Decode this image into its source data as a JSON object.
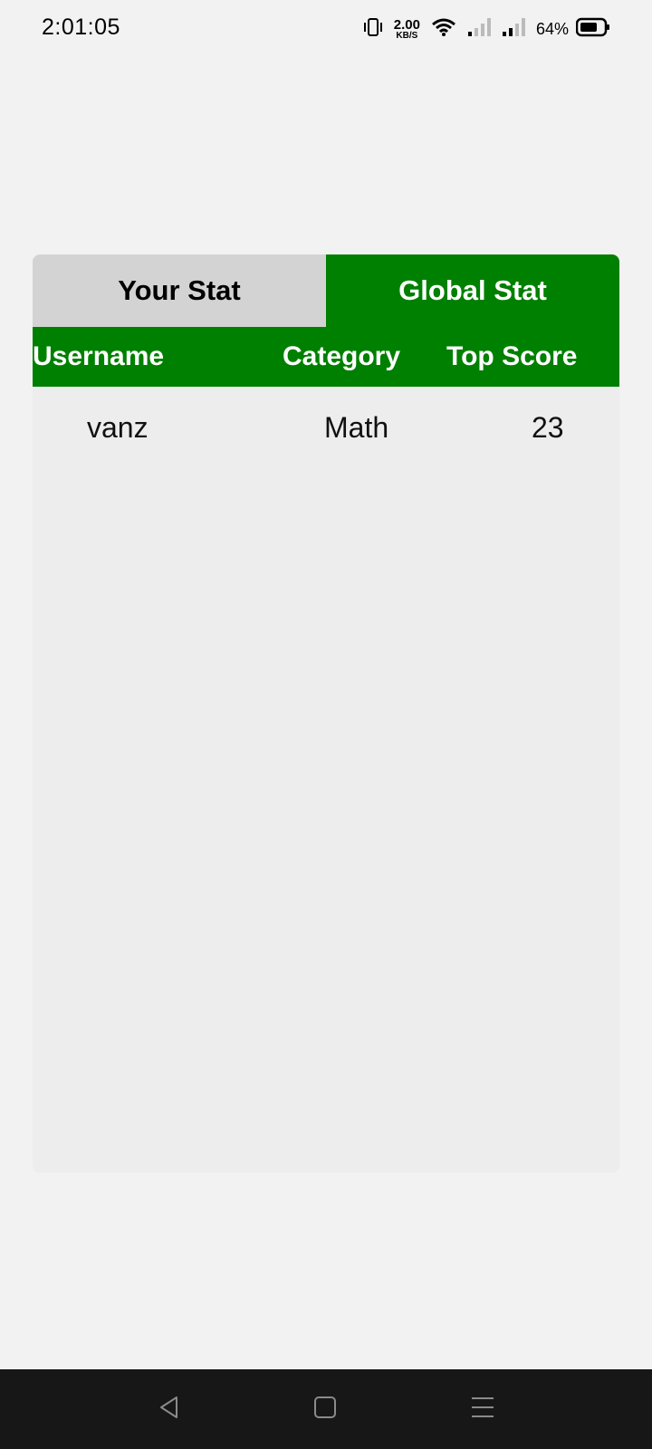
{
  "status_bar": {
    "time": "2:01:05",
    "net_speed_value": "2.00",
    "net_speed_unit": "KB/S",
    "battery_percent": "64%",
    "icons": [
      "vibrate-icon",
      "wifi-icon",
      "signal-icon",
      "signal-icon",
      "battery-icon"
    ]
  },
  "tabs": [
    {
      "label": "Your Stat",
      "selected": false
    },
    {
      "label": "Global Stat",
      "selected": true
    }
  ],
  "table": {
    "columns": [
      "Username",
      "Category",
      "Top Score"
    ],
    "rows": [
      {
        "username": "vanz",
        "category": "Math",
        "top_score": "23"
      }
    ]
  },
  "nav_bar": {
    "buttons": [
      "back-icon",
      "home-icon",
      "recents-icon"
    ]
  },
  "colors": {
    "accent_green": "#008000",
    "tab_inactive": "#d3d3d3",
    "background": "#f2f2f2",
    "card": "#ededed",
    "nav_bar": "#171717"
  }
}
